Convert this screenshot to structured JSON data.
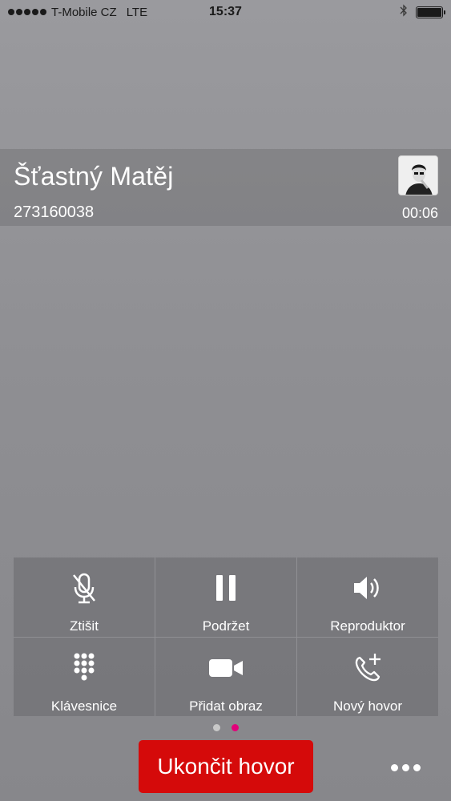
{
  "status_bar": {
    "carrier": "T-Mobile CZ",
    "network": "LTE",
    "time": "15:37",
    "signal_bars": 5,
    "battery_level": 1.0,
    "icons": [
      "signal-dots-icon",
      "bluetooth-icon",
      "battery-icon"
    ]
  },
  "call": {
    "contact_name": "Šťastný Matěj",
    "phone_number": "273160038",
    "duration": "00:06"
  },
  "controls": [
    {
      "label": "Ztišit",
      "icon": "mute-mic-icon"
    },
    {
      "label": "Podržet",
      "icon": "pause-icon"
    },
    {
      "label": "Reproduktor",
      "icon": "speaker-icon"
    },
    {
      "label": "Klávesnice",
      "icon": "keypad-icon"
    },
    {
      "label": "Přidat obraz",
      "icon": "video-camera-icon"
    },
    {
      "label": "Nový hovor",
      "icon": "add-call-icon"
    }
  ],
  "pagination": {
    "pages": 2,
    "active_page": 2
  },
  "end_call_label": "Ukončit hovor",
  "colors": {
    "end_call": "#d50a0a",
    "active_dot": "#e2007a",
    "inactive_dot": "#c8c8c8"
  }
}
